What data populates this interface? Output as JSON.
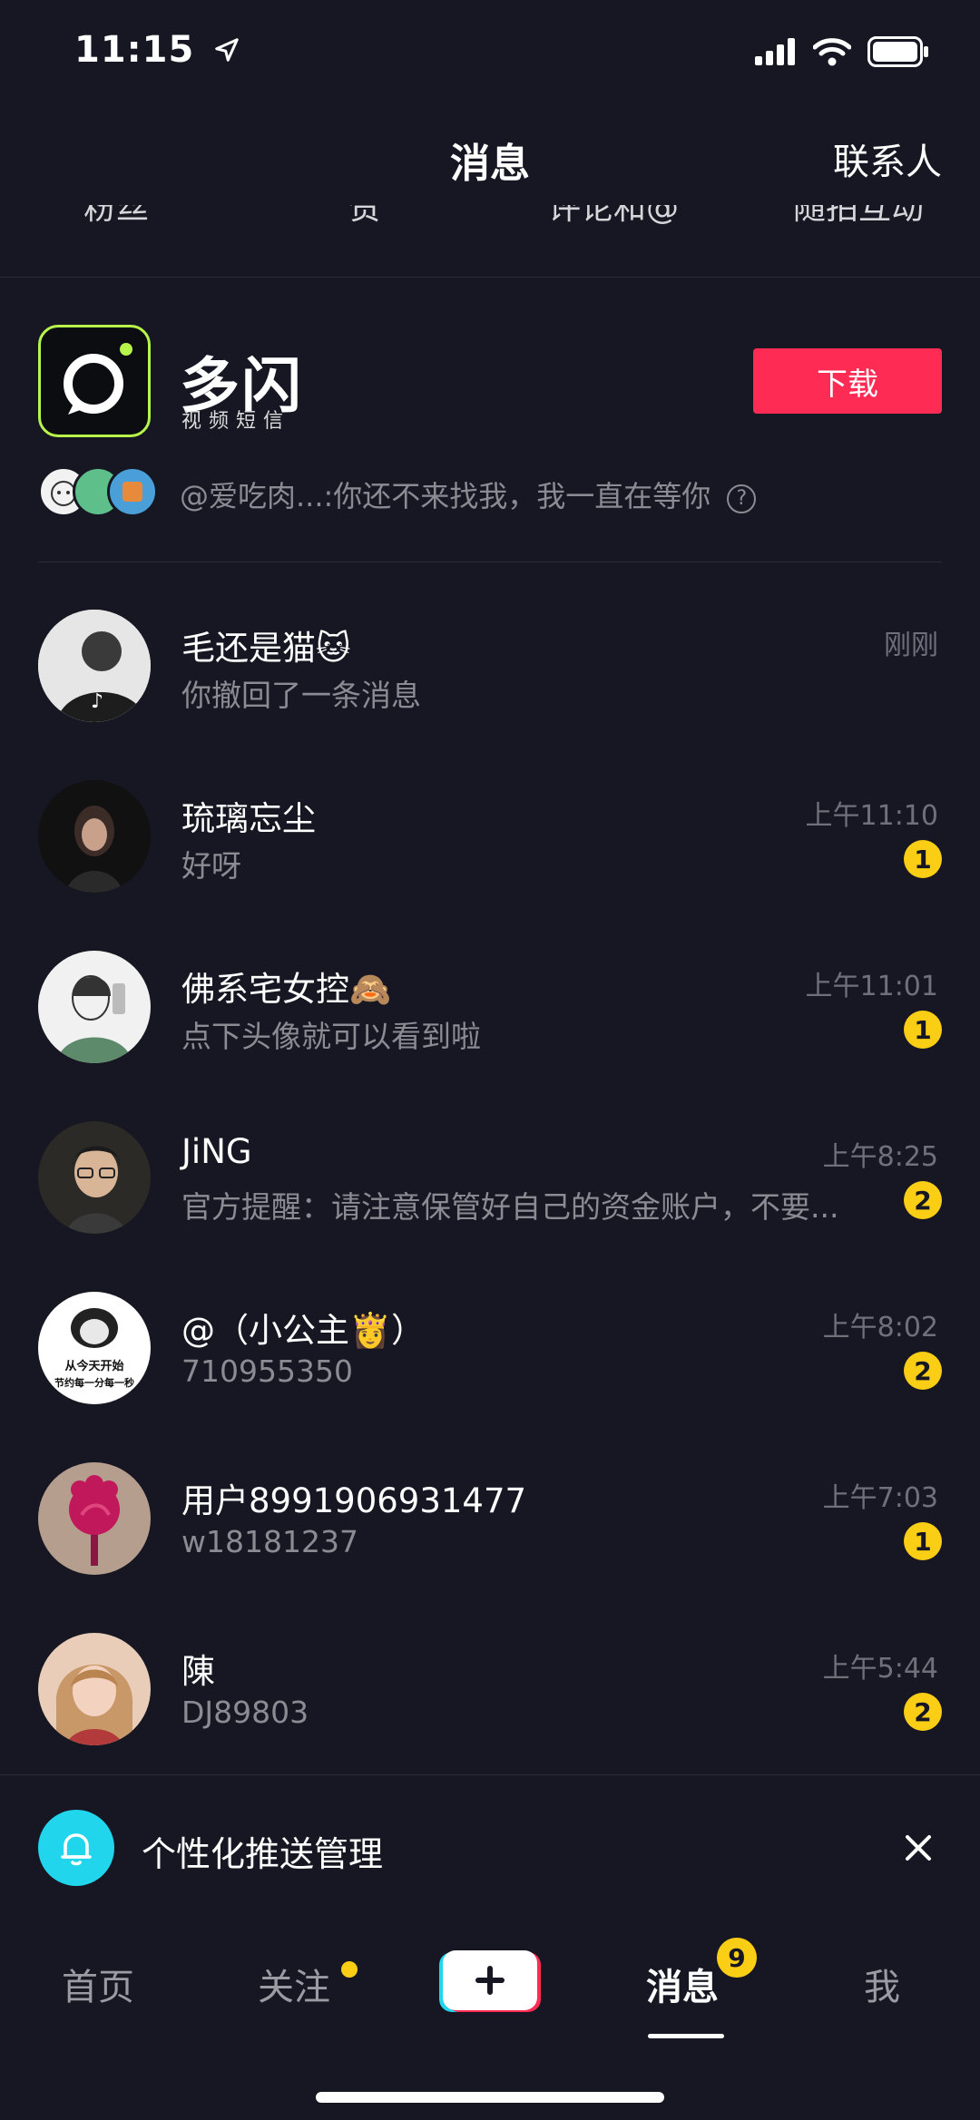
{
  "status_bar": {
    "time": "11:15"
  },
  "header": {
    "title": "消息",
    "contacts_label": "联系人"
  },
  "categories": [
    "粉丝",
    "赞",
    "评论和@",
    "随拍互动"
  ],
  "promo": {
    "brand": "多闪",
    "subtitle": "视频短信",
    "download_label": "下载",
    "message": "@爱吃肉...:你还不来找我，我一直在等你",
    "help_symbol": "?",
    "accent_color": "#fe2c55"
  },
  "conversations": [
    {
      "name": "毛还是猫🐱",
      "message": "你撤回了一条消息",
      "time": "刚刚",
      "badge": ""
    },
    {
      "name": "琉璃忘尘",
      "message": "好呀",
      "time": "上午11:10",
      "badge": "1"
    },
    {
      "name": "佛系宅女控🙈",
      "message": "点下头像就可以看到啦",
      "time": "上午11:01",
      "badge": "1"
    },
    {
      "name": "JiNG",
      "message": "官方提醒：请注意保管好自己的资金账户，不要...",
      "time": "上午8:25",
      "badge": "2"
    },
    {
      "name": "@（小公主👸）",
      "message": "710955350",
      "time": "上午8:02",
      "badge": "2"
    },
    {
      "name": "用户8991906931477",
      "message": "w18181237",
      "time": "上午7:03",
      "badge": "1"
    },
    {
      "name": "陳",
      "message": "DJ89803",
      "time": "上午5:44",
      "badge": "2"
    }
  ],
  "avatar_texts": {
    "sticker_top": "从今天开始",
    "sticker_bottom": "节约每一分每一秒"
  },
  "push": {
    "text": "个性化推送管理"
  },
  "tabs": {
    "home": "首页",
    "follow": "关注",
    "messages": "消息",
    "messages_badge": "9",
    "me": "我"
  },
  "colors": {
    "background": "#161722",
    "badge": "#face15",
    "bell": "#20d5ec"
  }
}
